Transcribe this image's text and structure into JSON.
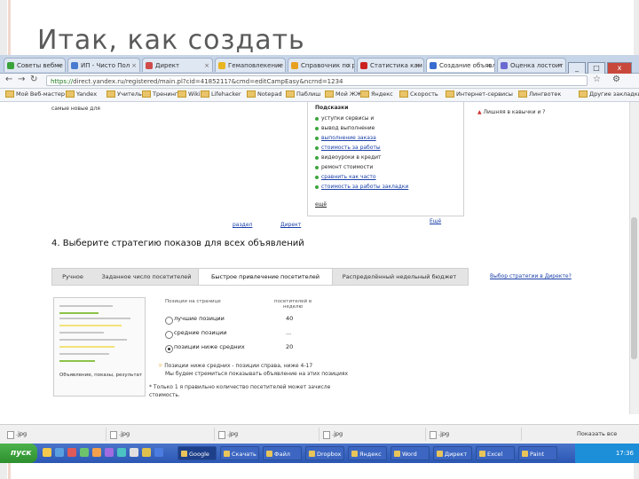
{
  "slide_title": "Итак, как создать",
  "browser": {
    "tabs": [
      {
        "label": "Советы вебме",
        "color": "#3aa33a"
      },
      {
        "label": "ИП - Чисто Пол",
        "color": "#4a7bd0"
      },
      {
        "label": "Директ",
        "color": "#d04a4a"
      },
      {
        "label": "Гемаповлекение",
        "color": "#e8b520"
      },
      {
        "label": "Справочник по р",
        "color": "#e8a020"
      },
      {
        "label": "Статистика кам",
        "color": "#cc2020"
      },
      {
        "label": "Создание объявл",
        "color": "#3a6bd0"
      },
      {
        "label": "Оценка лостоит",
        "color": "#6a6ad0"
      }
    ],
    "url_secure": "https://",
    "url_rest": "direct.yandex.ru/registered/main.pl?cid=4185211?&cmd=editCampEasy&ncrnd=1234",
    "bookmarks": [
      "Мой Веб-мастер",
      "Yandex",
      "Учитель",
      "Тренинги",
      "Wiki",
      "Lifehacker",
      "Notepad",
      "Паблиш",
      "Мой ЖЖ",
      "Яндекс",
      "Скорость",
      "Интернет-сервисы",
      "Лингвотек",
      "Другие закладки"
    ]
  },
  "content": {
    "top_left_text": "самые новые для",
    "panel_title": "Подсказки",
    "panel_items": [
      "уступки сервисы и",
      "вывод выполнение",
      "выполнение заказа",
      "стоимость за работы",
      "видеоуроки в кредит",
      "ремонт стоимости",
      "сравнить как часто",
      "стоимость за работы закладки"
    ],
    "panel_link": "ещё",
    "right_warning": "Лишняя в кавычки и ?",
    "bottom_links": [
      "раздел",
      "Директ",
      "Ещё"
    ],
    "step4_title": "4. Выберите стратегию показов для всех объявлений",
    "strategy_help_link": "Выбор стратегии в Директе?",
    "strategy_tabs": [
      "Ручное",
      "Заданное число посетителей",
      "Быстрое привлечение посетителей",
      "Распределённый недельный бюджет"
    ],
    "table_header_left": "Позиции на странице",
    "table_header_right": "посетителей в неделю",
    "table_rows": [
      {
        "label": "лучшие позиции",
        "value": "40",
        "selected": false
      },
      {
        "label": "средние позиции",
        "value": "...",
        "selected": false
      },
      {
        "label": "позиции ниже средних",
        "value": "20",
        "selected": true
      }
    ],
    "thumb_caption": "Объявление, показы, результат",
    "note_line1": "Позиции ниже средних - позиции справа, ниже 4-17",
    "note_line2": "Мы будем стремиться показывать объявление на этих позициях",
    "note_line3": "* Только 1 я правильно количество посетителей может зачисле",
    "note_line4": "стоимость."
  },
  "downloads": [
    ".jpg",
    ".jpg",
    ".jpg",
    ".jpg",
    ".jpg"
  ],
  "show_all_downloads": "Показать все",
  "taskbar": {
    "start_label": "пуск",
    "tasks": [
      "Google",
      "Скачать",
      "Файл",
      "Dropbox",
      "Яндекс",
      "Word",
      "Директ",
      "Excel",
      "Paint"
    ],
    "clock": "17:36"
  }
}
